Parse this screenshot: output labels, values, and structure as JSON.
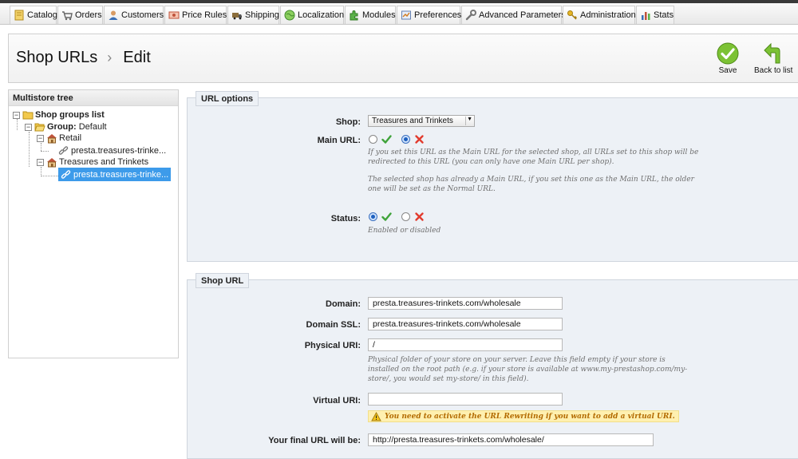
{
  "nav": {
    "tabs": [
      {
        "label": "Catalog",
        "icon": "catalog-icon"
      },
      {
        "label": "Orders",
        "icon": "orders-icon"
      },
      {
        "label": "Customers",
        "icon": "customers-icon"
      },
      {
        "label": "Price Rules",
        "icon": "price-rules-icon"
      },
      {
        "label": "Shipping",
        "icon": "shipping-icon"
      },
      {
        "label": "Localization",
        "icon": "localization-icon"
      },
      {
        "label": "Modules",
        "icon": "modules-icon"
      },
      {
        "label": "Preferences",
        "icon": "preferences-icon"
      },
      {
        "label": "Advanced Parameters",
        "icon": "wrench-icon"
      },
      {
        "label": "Administration",
        "icon": "key-icon"
      },
      {
        "label": "Stats",
        "icon": "stats-icon"
      }
    ]
  },
  "header": {
    "breadcrumb_parent": "Shop URLs",
    "separator": "›",
    "breadcrumb_current": "Edit",
    "save_label": "Save",
    "back_label": "Back to list"
  },
  "tree": {
    "title": "Multistore tree",
    "root": "Shop groups list",
    "group_prefix": "Group:",
    "group_name": "Default",
    "shop1": "Retail",
    "shop1_url": "presta.treasures-trinke...",
    "shop2": "Treasures and Trinkets",
    "shop2_url": "presta.treasures-trinke..."
  },
  "url_options": {
    "legend": "URL options",
    "shop_label": "Shop:",
    "shop_value": "Treasures and Trinkets",
    "main_label": "Main URL:",
    "main_value": "yes",
    "main_hint1": "If you set this URL as the Main URL for the selected shop, all URLs set to this shop will be redirected to this URL (you can only have one Main URL per shop).",
    "main_hint2": "The selected shop has already a Main URL, if you set this one as the Main URL, the older one will be set as the Normal URL.",
    "status_label": "Status:",
    "status_value": "enabled",
    "status_hint": "Enabled or disabled"
  },
  "shop_url": {
    "legend": "Shop URL",
    "domain_label": "Domain:",
    "domain_value": "presta.treasures-trinkets.com/wholesale",
    "domain_ssl_label": "Domain SSL:",
    "domain_ssl_value": "presta.treasures-trinkets.com/wholesale",
    "physical_label": "Physical URI:",
    "physical_value": "/",
    "physical_hint": "Physical folder of your store on your server. Leave this field empty if your store is installed on the root path (e.g. if your store is available at www.my-prestashop.com/my-store/, you would set my-store/ in this field).",
    "virtual_label": "Virtual URI:",
    "virtual_value": "",
    "virtual_warning": "You need to activate the URL Rewriting if you want to add a virtual URI.",
    "final_label": "Your final URL will be:",
    "final_value": "http://presta.treasures-trinkets.com/wholesale/"
  },
  "colors": {
    "selected_node": "#3d9bea",
    "fieldset_bg": "#edf1f6",
    "save_green": "#7cc234",
    "warning_bg": "#fff0b0"
  }
}
